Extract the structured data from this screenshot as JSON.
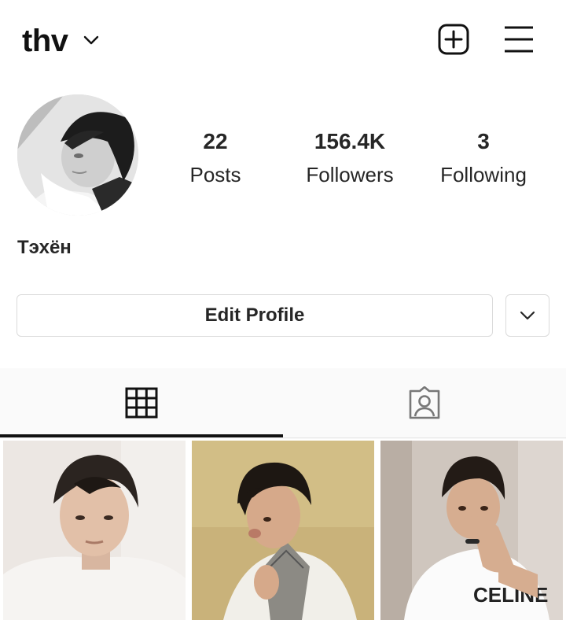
{
  "header": {
    "username": "thv",
    "icons": {
      "dropdown": "chevron-down-icon",
      "new_post": "plus-square-icon",
      "menu": "hamburger-menu-icon"
    }
  },
  "profile": {
    "display_name": "Тэхён",
    "stats": [
      {
        "value": "22",
        "label": "Posts"
      },
      {
        "value": "156.4K",
        "label": "Followers"
      },
      {
        "value": "3",
        "label": "Following"
      }
    ]
  },
  "actions": {
    "edit_profile_label": "Edit Profile",
    "suggestions_icon": "chevron-down-icon"
  },
  "tabs": [
    {
      "name": "grid",
      "icon": "grid-icon",
      "active": true
    },
    {
      "name": "tagged",
      "icon": "tagged-person-icon",
      "active": false
    }
  ],
  "colors": {
    "text": "#262626",
    "border": "#dbdbdb",
    "tab_bar_background": "#fafafa",
    "active_indicator": "#111111"
  }
}
